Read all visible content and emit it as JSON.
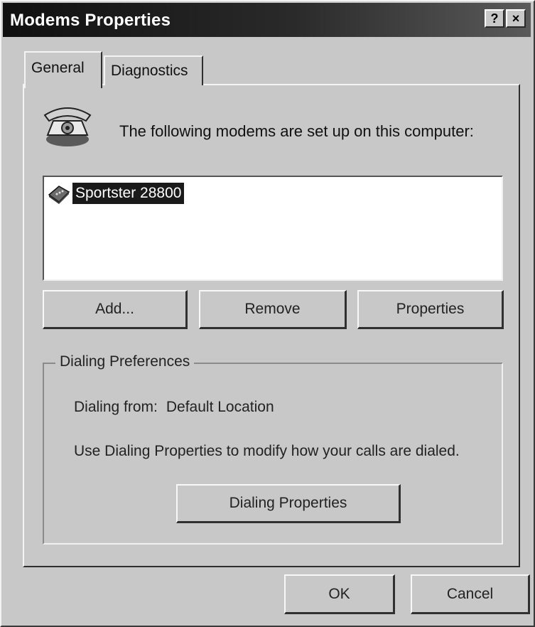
{
  "window": {
    "title": "Modems Properties",
    "help_label": "?",
    "close_label": "×"
  },
  "tabs": [
    {
      "label": "General",
      "active": true
    },
    {
      "label": "Diagnostics",
      "active": false
    }
  ],
  "general": {
    "intro_text": "The following modems are set up on this computer:",
    "modems": [
      {
        "name": "Sportster 28800",
        "selected": true,
        "icon": "modem-icon"
      }
    ],
    "buttons": {
      "add": "Add...",
      "remove": "Remove",
      "properties": "Properties"
    },
    "dialing": {
      "group_label": "Dialing Preferences",
      "from_label": "Dialing from:",
      "from_value": "Default Location",
      "help_text": "Use Dialing Properties to modify how your calls are dialed.",
      "button": "Dialing Properties"
    }
  },
  "footer": {
    "ok": "OK",
    "cancel": "Cancel"
  },
  "colors": {
    "face": "#c8c8c8",
    "title_bar": "#101010",
    "selection": "#1a1a1a"
  }
}
